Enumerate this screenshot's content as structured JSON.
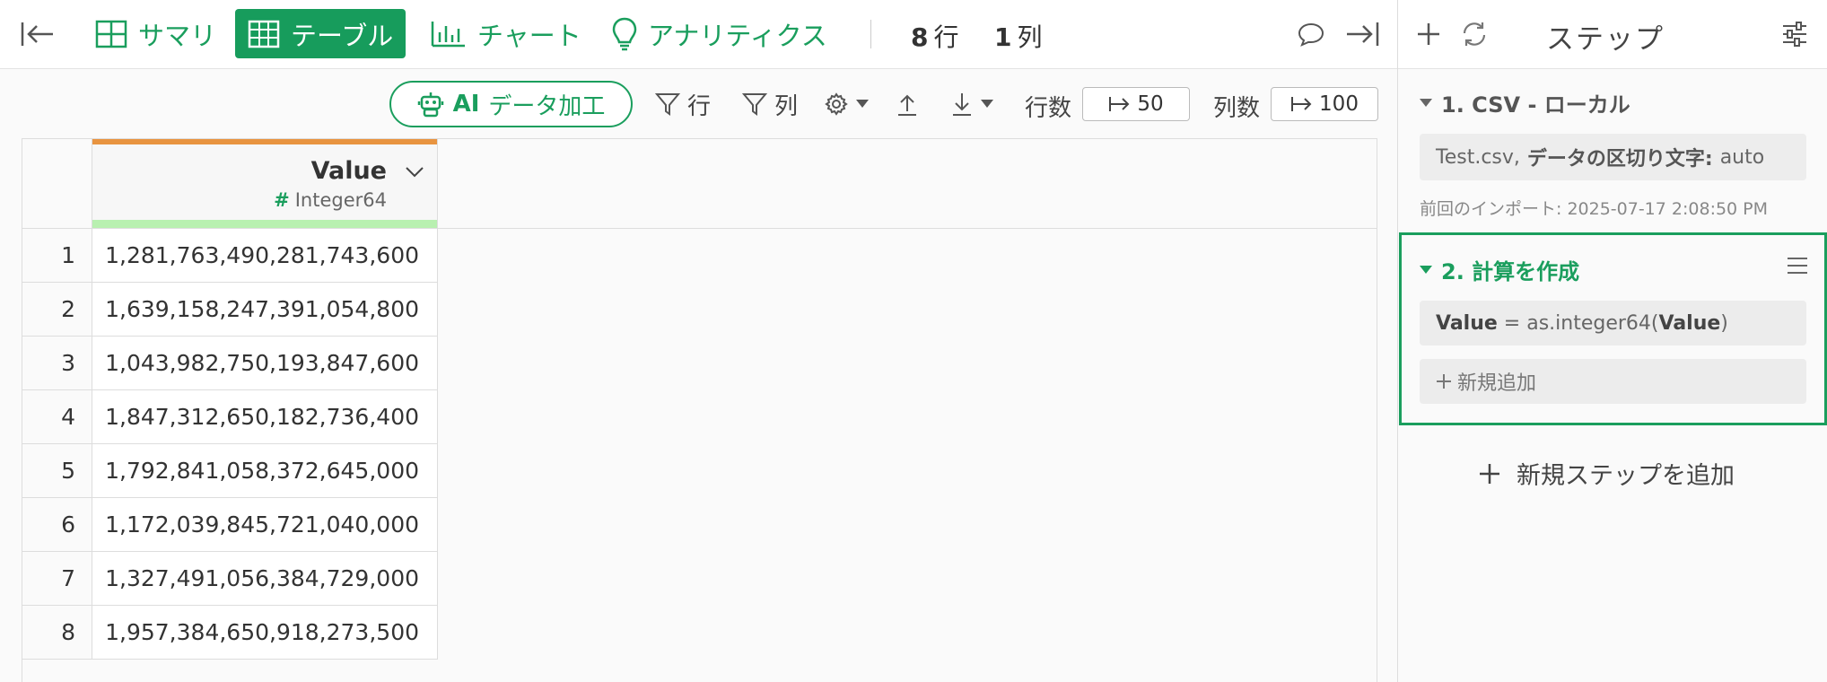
{
  "topbar": {
    "tabs": [
      {
        "label": "サマリ",
        "icon": "summary-grid-icon"
      },
      {
        "label": "テーブル",
        "icon": "table-icon",
        "active": true
      },
      {
        "label": "チャート",
        "icon": "bar-chart-icon"
      },
      {
        "label": "アナリティクス",
        "icon": "lightbulb-icon"
      }
    ],
    "row_count": {
      "number": "8",
      "unit": "行"
    },
    "col_count": {
      "number": "1",
      "unit": "列"
    }
  },
  "toolbar": {
    "ai_button": {
      "ai": "AI",
      "label": "データ加工"
    },
    "filter_rows": "行",
    "filter_cols": "列",
    "rows_label": "行数",
    "rows_value": "50",
    "cols_label": "列数",
    "cols_value": "100"
  },
  "table": {
    "column": {
      "name": "Value",
      "type_symbol": "#",
      "type": "Integer64"
    },
    "rows": [
      {
        "n": "1",
        "value": "1,281,763,490,281,743,600"
      },
      {
        "n": "2",
        "value": "1,639,158,247,391,054,800"
      },
      {
        "n": "3",
        "value": "1,043,982,750,193,847,600"
      },
      {
        "n": "4",
        "value": "1,847,312,650,182,736,400"
      },
      {
        "n": "5",
        "value": "1,792,841,058,372,645,000"
      },
      {
        "n": "6",
        "value": "1,172,039,845,721,040,000"
      },
      {
        "n": "7",
        "value": "1,327,491,056,384,729,000"
      },
      {
        "n": "8",
        "value": "1,957,384,650,918,273,500"
      }
    ]
  },
  "panel": {
    "title": "ステップ",
    "step1": {
      "title": "1. CSV - ローカル",
      "file": "Test.csv,",
      "delimiter_label": "データの区切り文字:",
      "delimiter_value": "auto",
      "import_time": "前回のインポート: 2025-07-17 2:08:50 PM"
    },
    "step2": {
      "title": "2. 計算を作成",
      "formula_col": "Value",
      "formula_eq": " = as.integer64(",
      "formula_arg": "Value",
      "formula_close": ")",
      "add_label": "新規追加"
    },
    "add_step": "新規ステップを追加"
  },
  "colors": {
    "accent": "#1a9e5d",
    "header_stripe": "#e89440",
    "type_stripe": "#b8f0b0"
  }
}
